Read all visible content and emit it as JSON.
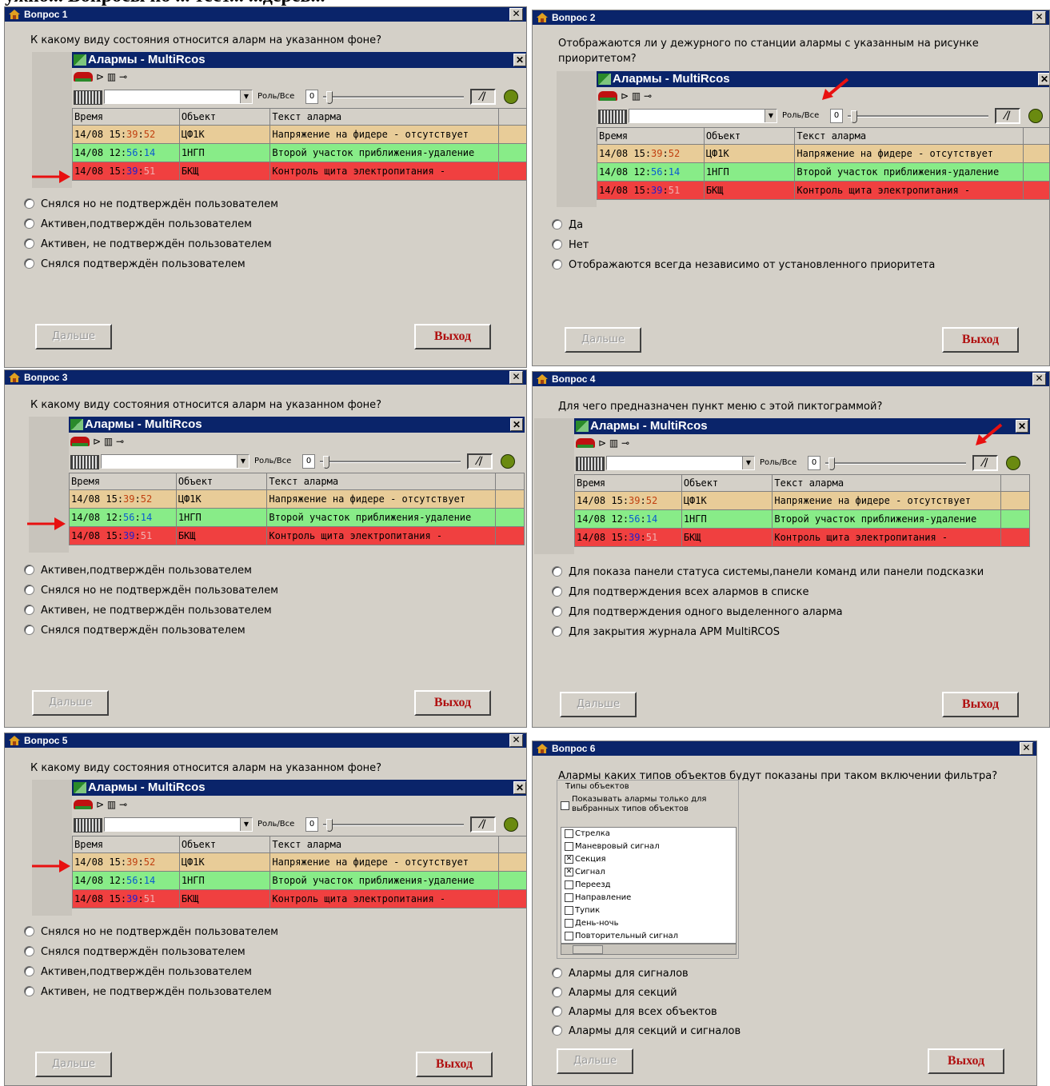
{
  "page_heading_cropped": "ужно... Вопросы по ... тест... ...дерев...",
  "common": {
    "next_label": "Дальше",
    "exit_label": "Выход",
    "alarms_title": "Алармы - MultiRcos",
    "role_label": "Роль/Все",
    "zero": "0",
    "col_time": "Время",
    "col_object": "Объект",
    "col_text": "Текст аларма",
    "rows": [
      {
        "date": "14/08",
        "hh": "15",
        "mm": "39",
        "ss": "52",
        "object": "ЦФ1К",
        "text": "Напряжение на фидере - отсутствует"
      },
      {
        "date": "14/08",
        "hh": "12",
        "mm": "56",
        "ss": "14",
        "object": "1НГП",
        "text": "Второй участок приближения-удаление"
      },
      {
        "date": "14/08",
        "hh": "15",
        "mm": "39",
        "ss": "51",
        "object": "БКЩ",
        "text": "Контроль щита электропитания - "
      }
    ]
  },
  "q1": {
    "title": "Вопрос  1",
    "question": "К какому виду состояния относится аларм на указанном фоне?",
    "options": [
      "Снялся но не подтверждён пользователем",
      "Активен,подтверждён пользователем",
      "Активен, не подтверждён пользователем",
      "Снялся  подтверждён пользователем"
    ]
  },
  "q2": {
    "title": "Вопрос  2",
    "question": "Отображаются ли у дежурного по станции алармы  с указанным на рисунке приоритетом?",
    "options": [
      "Да",
      "Нет",
      "Отображаются всегда независимо от установленного приоритета"
    ]
  },
  "q3": {
    "title": "Вопрос  3",
    "question": "К какому виду состояния относится аларм на указанном фоне?",
    "options": [
      "Активен,подтверждён пользователем",
      "Снялся но не подтверждён пользователем",
      "Активен, не подтверждён пользователем",
      "Снялся  подтверждён пользователем"
    ]
  },
  "q4": {
    "title": "Вопрос  4",
    "question": "Для чего предназначен пункт меню с этой пиктограммой?",
    "options": [
      "Для показа панели статуса системы,панели команд или панели подсказки",
      "Для подтверждения всех алармов в списке",
      "Для подтверждения одного выделенного аларма",
      "Для закрытия журнала  АРМ MultiRCOS"
    ]
  },
  "q5": {
    "title": "Вопрос  5",
    "question": "К какому виду состояния относится аларм на указанном фоне?",
    "options": [
      "Снялся но не подтверждён пользователем",
      "Снялся  подтверждён пользователем",
      "Активен,подтверждён пользователем",
      "Активен, не подтверждён пользователем"
    ]
  },
  "q6": {
    "title": "Вопрос  6",
    "question": "Алармы каких типов объектов будут показаны при таком включении фильтра?",
    "filter_title": "Типы объектов",
    "filter_checkbox": "Показывать алармы только для выбранных типов объектов",
    "filter_items": [
      {
        "label": "Стрелка",
        "checked": false
      },
      {
        "label": "Маневровый сигнал",
        "checked": false
      },
      {
        "label": "Секция",
        "checked": true
      },
      {
        "label": "Сигнал",
        "checked": true
      },
      {
        "label": "Переезд",
        "checked": false
      },
      {
        "label": "Направление",
        "checked": false
      },
      {
        "label": "Тупик",
        "checked": false
      },
      {
        "label": "День-ночь",
        "checked": false
      },
      {
        "label": "Повторительный сигнал",
        "checked": false
      }
    ],
    "options": [
      "Алармы для сигналов",
      "Алармы для секций",
      "Алармы для всех объектов",
      "Алармы для секций и сигналов"
    ]
  }
}
